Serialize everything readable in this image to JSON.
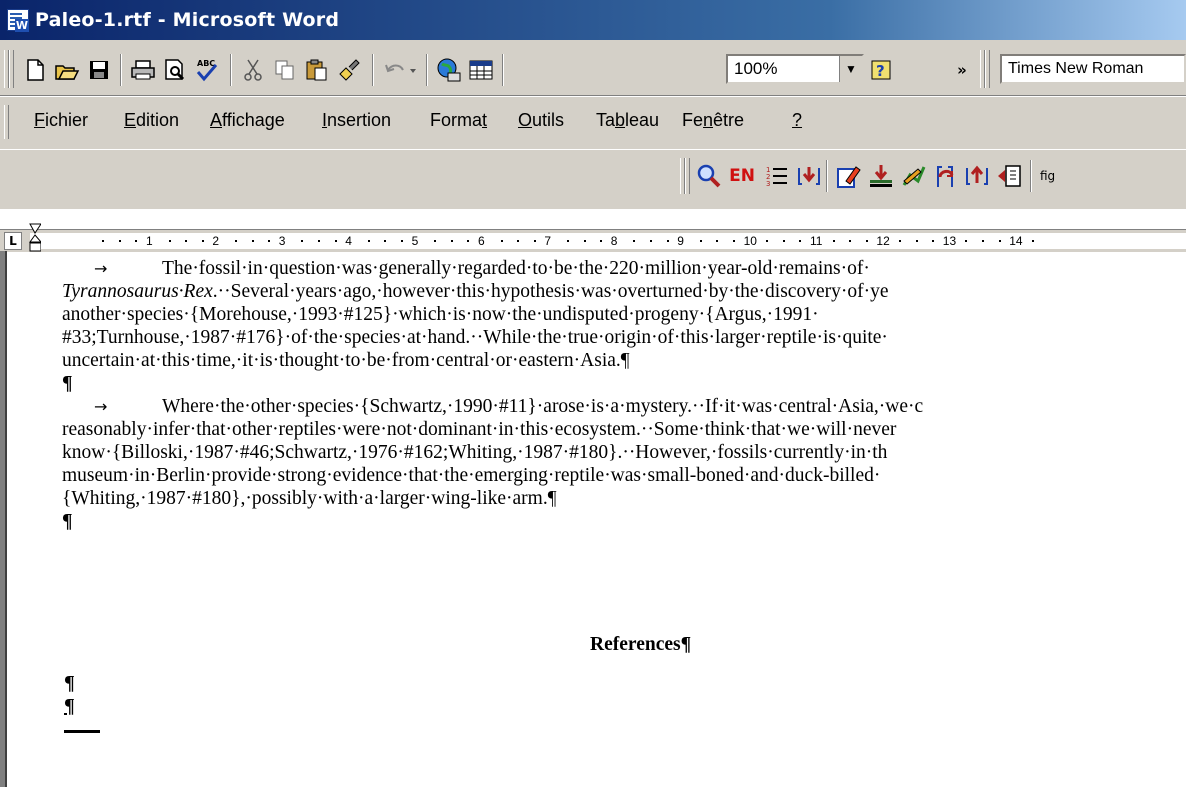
{
  "window": {
    "title": "Paleo-1.rtf - Microsoft Word"
  },
  "toolbar": {
    "icons": [
      "new-icon",
      "open-icon",
      "save-icon",
      "print-icon",
      "print-preview-icon",
      "spelling-icon",
      "cut-icon",
      "copy-icon",
      "paste-icon",
      "format-painter-icon",
      "undo-icon",
      "web-icon",
      "table-icon",
      "help-icon"
    ],
    "zoom": "100%",
    "font": "Times New Roman",
    "more": "»"
  },
  "menu": {
    "items": [
      {
        "pre": "",
        "u": "F",
        "post": "ichier"
      },
      {
        "pre": "",
        "u": "E",
        "post": "dition"
      },
      {
        "pre": "",
        "u": "A",
        "post": "ffichage"
      },
      {
        "pre": "",
        "u": "I",
        "post": "nsertion"
      },
      {
        "pre": "Forma",
        "u": "t",
        "post": ""
      },
      {
        "pre": "",
        "u": "O",
        "post": "utils"
      },
      {
        "pre": "Ta",
        "u": "b",
        "post": "leau"
      },
      {
        "pre": "Fe",
        "u": "n",
        "post": "être"
      },
      {
        "pre": "",
        "u": "?",
        "post": ""
      }
    ]
  },
  "endnote_toolbar": {
    "en_label": "EN",
    "fig_label": "fig"
  },
  "ruler": {
    "numbers": [
      "1",
      "2",
      "3",
      "4",
      "5",
      "6",
      "7",
      "8",
      "9",
      "10",
      "11",
      "12",
      "13",
      "14"
    ],
    "tab_marker": "L"
  },
  "document": {
    "p1": [
      "The·fossil·in·question·was·generally·regarded·to·be·the·220·million·year-old·remains·of·",
      "Tyrannosaurus·Rex.··Several·years·ago,·however·this·hypothesis·was·overturned·by·the·discovery·of·ye",
      "another·species·{Morehouse,·1993·#125}·which·is·now·the·undisputed·progeny·{Argus,·1991·",
      "#33;Turnhouse,·1987·#176}·of·the·species·at·hand.··While·the·true·origin·of·this·larger·reptile·is·quite·",
      "uncertain·at·this·time,·it·is·thought·to·be·from·central·or·eastern·Asia.¶"
    ],
    "p1_italic": "Tyrannosaurus·Rex",
    "p2": [
      "Where·the·other·species·{Schwartz,·1990·#11}·arose·is·a·mystery.··If·it·was·central·Asia,·we·c",
      "reasonably·infer·that·other·reptiles·were·not·dominant·in·this·ecosystem.··Some·think·that·we·will·never",
      "know·{Billoski,·1987·#46;Schwartz,·1976·#162;Whiting,·1987·#180}.··However,·fossils·currently·in·th",
      "museum·in·Berlin·provide·strong·evidence·that·the·emerging·reptile·was·small-boned·and·duck-billed·",
      "{Whiting,·1987·#180},·possibly·with·a·larger·wing-like·arm.¶"
    ],
    "tab_arrow": "→",
    "pilcrow": "¶",
    "references": "References¶"
  }
}
